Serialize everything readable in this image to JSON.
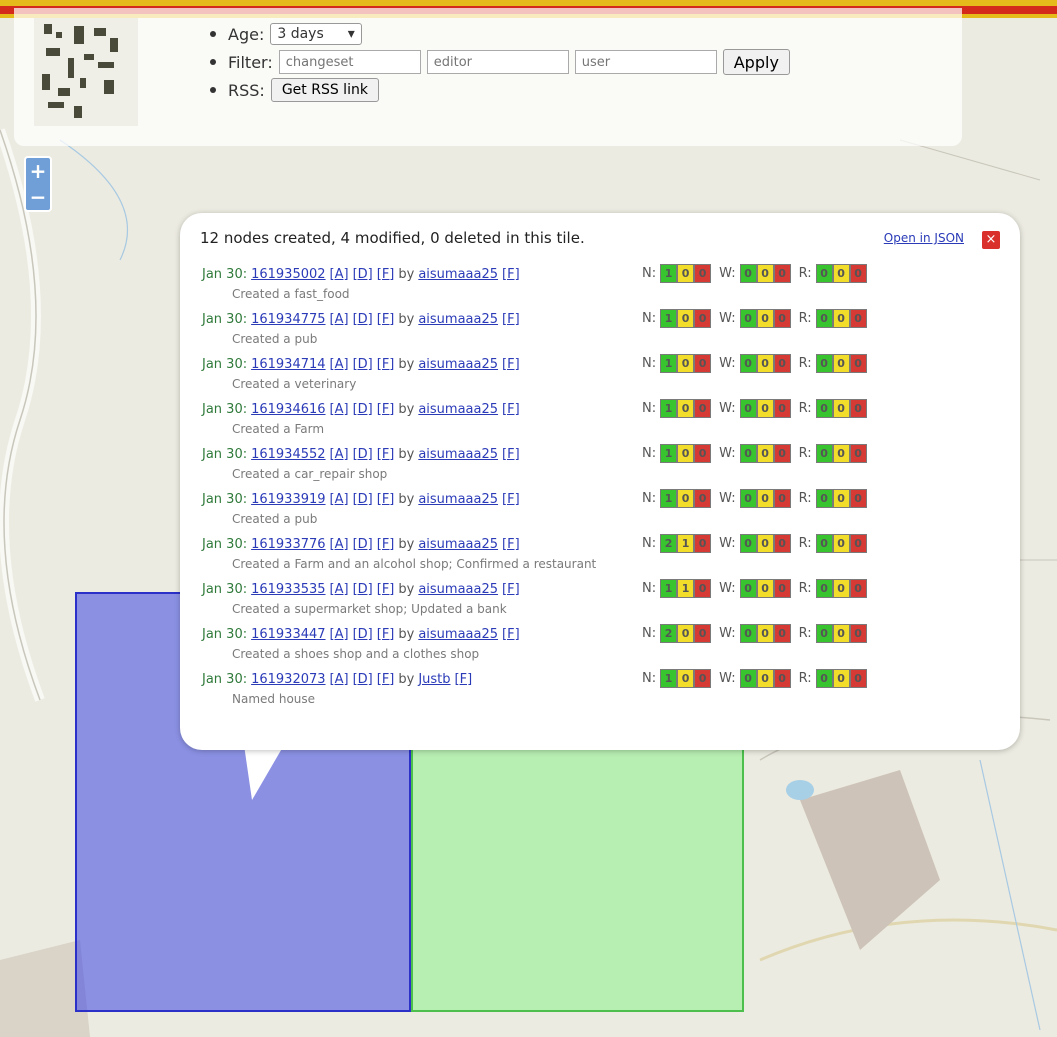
{
  "controls": {
    "age_label": "Age:",
    "age_value": "3 days",
    "filter_label": "Filter:",
    "filter_changeset_placeholder": "changeset",
    "filter_editor_placeholder": "editor",
    "filter_user_placeholder": "user",
    "apply_label": "Apply",
    "rss_label": "RSS:",
    "rss_button_label": "Get RSS link"
  },
  "zoom": {
    "in": "+",
    "out": "−"
  },
  "popup": {
    "summary": "12 nodes created, 4 modified, 0 deleted in this tile.",
    "json_link": "Open in JSON",
    "close": "×",
    "rows": [
      {
        "date": "Jan 30:",
        "changeset": "161935002",
        "a": "[A]",
        "d": "[D]",
        "f": "[F]",
        "by": "by",
        "user": "aisumaaa25",
        "uf": "[F]",
        "desc": "Created a fast_food",
        "n": [
          "1",
          "0",
          "0"
        ],
        "w": [
          "0",
          "0",
          "0"
        ],
        "r": [
          "0",
          "0",
          "0"
        ]
      },
      {
        "date": "Jan 30:",
        "changeset": "161934775",
        "a": "[A]",
        "d": "[D]",
        "f": "[F]",
        "by": "by",
        "user": "aisumaaa25",
        "uf": "[F]",
        "desc": "Created a pub",
        "n": [
          "1",
          "0",
          "0"
        ],
        "w": [
          "0",
          "0",
          "0"
        ],
        "r": [
          "0",
          "0",
          "0"
        ]
      },
      {
        "date": "Jan 30:",
        "changeset": "161934714",
        "a": "[A]",
        "d": "[D]",
        "f": "[F]",
        "by": "by",
        "user": "aisumaaa25",
        "uf": "[F]",
        "desc": "Created a veterinary",
        "n": [
          "1",
          "0",
          "0"
        ],
        "w": [
          "0",
          "0",
          "0"
        ],
        "r": [
          "0",
          "0",
          "0"
        ]
      },
      {
        "date": "Jan 30:",
        "changeset": "161934616",
        "a": "[A]",
        "d": "[D]",
        "f": "[F]",
        "by": "by",
        "user": "aisumaaa25",
        "uf": "[F]",
        "desc": "Created a Farm",
        "n": [
          "1",
          "0",
          "0"
        ],
        "w": [
          "0",
          "0",
          "0"
        ],
        "r": [
          "0",
          "0",
          "0"
        ]
      },
      {
        "date": "Jan 30:",
        "changeset": "161934552",
        "a": "[A]",
        "d": "[D]",
        "f": "[F]",
        "by": "by",
        "user": "aisumaaa25",
        "uf": "[F]",
        "desc": "Created a car_repair shop",
        "n": [
          "1",
          "0",
          "0"
        ],
        "w": [
          "0",
          "0",
          "0"
        ],
        "r": [
          "0",
          "0",
          "0"
        ]
      },
      {
        "date": "Jan 30:",
        "changeset": "161933919",
        "a": "[A]",
        "d": "[D]",
        "f": "[F]",
        "by": "by",
        "user": "aisumaaa25",
        "uf": "[F]",
        "desc": "Created a pub",
        "n": [
          "1",
          "0",
          "0"
        ],
        "w": [
          "0",
          "0",
          "0"
        ],
        "r": [
          "0",
          "0",
          "0"
        ]
      },
      {
        "date": "Jan 30:",
        "changeset": "161933776",
        "a": "[A]",
        "d": "[D]",
        "f": "[F]",
        "by": "by",
        "user": "aisumaaa25",
        "uf": "[F]",
        "desc": "Created a Farm and an alcohol shop; Confirmed a restaurant",
        "n": [
          "2",
          "1",
          "0"
        ],
        "w": [
          "0",
          "0",
          "0"
        ],
        "r": [
          "0",
          "0",
          "0"
        ]
      },
      {
        "date": "Jan 30:",
        "changeset": "161933535",
        "a": "[A]",
        "d": "[D]",
        "f": "[F]",
        "by": "by",
        "user": "aisumaaa25",
        "uf": "[F]",
        "desc": "Created a supermarket shop; Updated a bank",
        "n": [
          "1",
          "1",
          "0"
        ],
        "w": [
          "0",
          "0",
          "0"
        ],
        "r": [
          "0",
          "0",
          "0"
        ]
      },
      {
        "date": "Jan 30:",
        "changeset": "161933447",
        "a": "[A]",
        "d": "[D]",
        "f": "[F]",
        "by": "by",
        "user": "aisumaaa25",
        "uf": "[F]",
        "desc": "Created a shoes shop and a clothes shop",
        "n": [
          "2",
          "0",
          "0"
        ],
        "w": [
          "0",
          "0",
          "0"
        ],
        "r": [
          "0",
          "0",
          "0"
        ]
      },
      {
        "date": "Jan 30:",
        "changeset": "161932073",
        "a": "[A]",
        "d": "[D]",
        "f": "[F]",
        "by": "by",
        "user": "Justb",
        "uf": "[F]",
        "desc": "Named house",
        "n": [
          "1",
          "0",
          "0"
        ],
        "w": [
          "0",
          "0",
          "0"
        ],
        "r": [
          "0",
          "0",
          "0"
        ]
      }
    ]
  },
  "labels": {
    "n": "N:",
    "w": "W:",
    "r": "R:"
  }
}
